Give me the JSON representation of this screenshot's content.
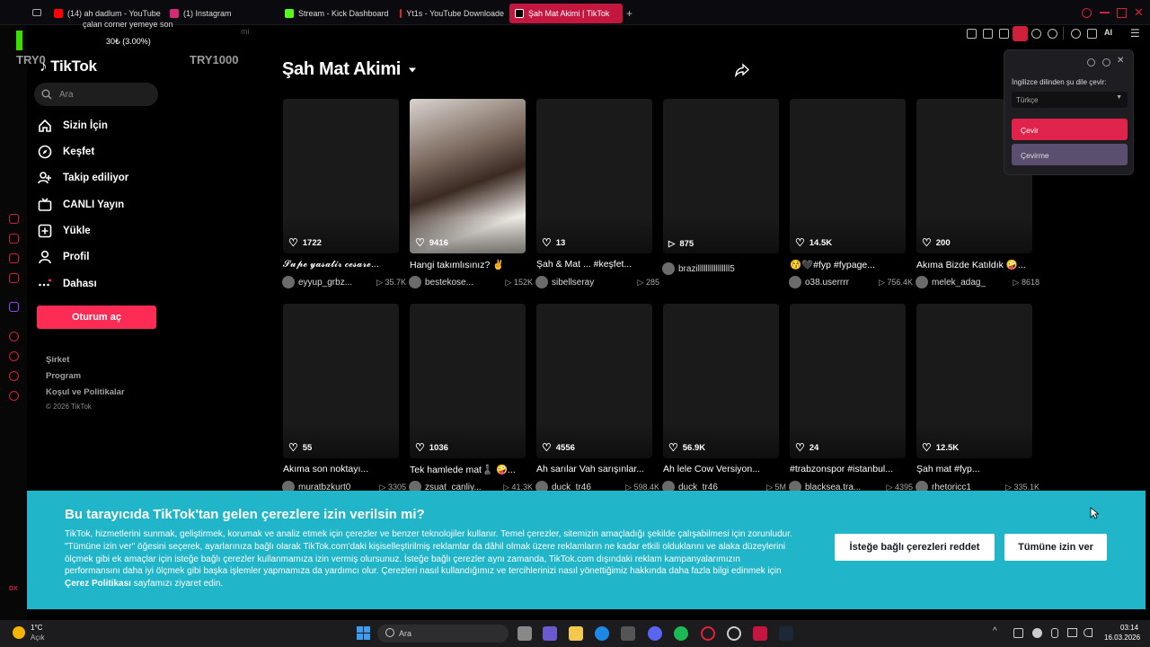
{
  "browser": {
    "tabs": [
      {
        "label": "(14) ah dadlum - YouTube",
        "color": "#ff0000"
      },
      {
        "label": "(1) Instagram",
        "color": "#d62976"
      },
      {
        "label": "Stream - Kick Dashboard",
        "color": "#53fc18"
      },
      {
        "label": "Yt1s - YouTube Downloade",
        "color": "#e0232e"
      },
      {
        "label": "Şah Mat Akimi | TikTok",
        "color": "#000000"
      }
    ],
    "new_tab": "+",
    "ai_label": "AI"
  },
  "overlay": {
    "line1": "çalan corner yemeye son",
    "line2": "30₺ (3.00%)",
    "left_label": "TRY0",
    "right_label": "TRY1000",
    "faint_text": "mi"
  },
  "sidebar": {
    "logo": "TikTok",
    "search_placeholder": "Ara",
    "nav": [
      {
        "label": "Sizin İçin",
        "icon": "home-icon"
      },
      {
        "label": "Keşfet",
        "icon": "compass-icon"
      },
      {
        "label": "Takip ediliyor",
        "icon": "following-icon"
      },
      {
        "label": "CANLI Yayın",
        "icon": "live-icon"
      },
      {
        "label": "Yükle",
        "icon": "upload-icon"
      },
      {
        "label": "Profil",
        "icon": "profile-icon"
      },
      {
        "label": "Dahası",
        "icon": "more-icon"
      }
    ],
    "login": "Oturum aç",
    "footer": [
      "Şirket",
      "Program",
      "Koşul ve Politikalar"
    ],
    "copyright": "© 2026 TikTok"
  },
  "main": {
    "title": "Şah Mat Akimi",
    "videos": [
      {
        "count": "1722",
        "icon": "heart",
        "caption": "𝓢𝓾𝓹𝓮 𝔂𝓪𝓼𝓪𝓽𝓲𝓻 𝓬𝓮𝓼𝓪𝓻𝓮...",
        "user": "eyyup_grbz...",
        "views": "35.7K"
      },
      {
        "count": "9416",
        "icon": "heart",
        "caption": "Hangi takımlısınız? ✌",
        "user": "bestekose...",
        "views": "152K"
      },
      {
        "count": "13",
        "icon": "heart",
        "caption": "Şah & Mat ... #keşfet...",
        "user": "sibellseray",
        "views": "285"
      },
      {
        "count": "875",
        "icon": "play",
        "caption": "",
        "user": "brazillllllllllllllll5",
        "views": ""
      },
      {
        "count": "14.5K",
        "icon": "heart",
        "caption": "😚🖤#fyp #fypage...",
        "user": "o38.userrrr",
        "views": "756.4K"
      },
      {
        "count": "200",
        "icon": "heart",
        "caption": "Akıma Bizde Katıldık 🤪...",
        "user": "melek_adag_",
        "views": "8618"
      },
      {
        "count": "55",
        "icon": "heart",
        "caption": "Akıma son noktayı...",
        "user": "muratbzkurt0",
        "views": "3305"
      },
      {
        "count": "1036",
        "icon": "heart",
        "caption": "Tek hamlede mat♟️ 🤪...",
        "user": "zsuat_canliy...",
        "views": "41.3K"
      },
      {
        "count": "4556",
        "icon": "heart",
        "caption": "Ah sarılar Vah sarışınlar...",
        "user": "duck_tr46",
        "views": "598.4K"
      },
      {
        "count": "56.9K",
        "icon": "heart",
        "caption": "Ah lele Cow Versiyon...",
        "user": "duck_tr46",
        "views": "5M"
      },
      {
        "count": "24",
        "icon": "heart",
        "caption": "#trabzonspor #istanbul...",
        "user": "blacksea.tra...",
        "views": "4395"
      },
      {
        "count": "12.5K",
        "icon": "heart",
        "caption": "Şah mat #fyp...",
        "user": "rhetoricc1",
        "views": "335.1K"
      }
    ]
  },
  "translate": {
    "label": "İngilizce dilinden şu dile çevir:",
    "language": "Türkçe",
    "translate_btn": "Çevir",
    "dont_btn": "Çevirme"
  },
  "cookie": {
    "title": "Bu tarayıcıda TikTok'tan gelen çerezlere izin verilsin mi?",
    "body": "TikTok, hizmetlerini sunmak, geliştirmek, korumak ve analiz etmek için çerezler ve benzer teknolojiler kullanır. Temel çerezler, sitemizin amaçladığı şekilde çalışabilmesi için zorunludur. \"Tümüne izin ver\" öğesini seçerek, ayarlarınıza bağlı olarak TikTok.com'daki kişiselleştirilmiş reklamlar da dâhil olmak üzere reklamların ne kadar etkili olduklarını ve alaka düzeylerini ölçmek gibi ek amaçlar için isteğe bağlı çerezler kullanmamıza izin vermiş olursunuz. İsteğe bağlı çerezler aynı zamanda, TikTok.com dışındaki reklam kampanyalarımızın performansını daha iyi ölçmek gibi başka işlemler yapmamıza da yardımcı olur. Çerezleri nasıl kullandığımız ve tercihlerinizi nasıl yönettiğimiz hakkında daha fazla bilgi edinmek için",
    "policy_link": "Çerez Politikası",
    "body_end": " sayfamızı ziyaret edin.",
    "reject": "İsteğe bağlı çerezleri reddet",
    "accept": "Tümüne izin ver"
  },
  "taskbar": {
    "weather_temp": "1°C",
    "weather_desc": "Açık",
    "search": "Ara",
    "time": "03:14",
    "date": "16.03.2026",
    "dx_label": "DX"
  }
}
